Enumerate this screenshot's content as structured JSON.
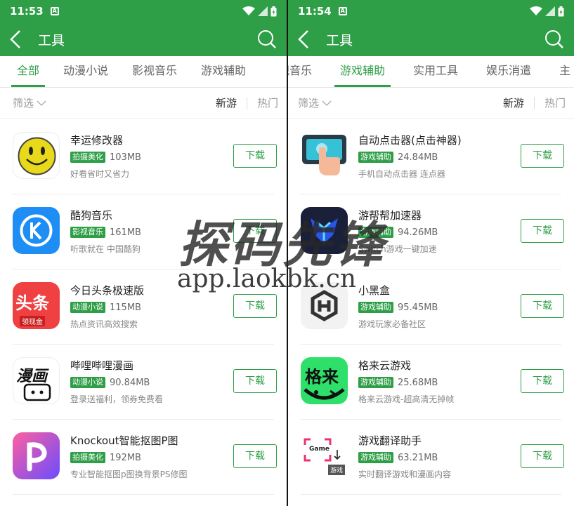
{
  "left": {
    "status": {
      "time": "11:53",
      "notif": "A"
    },
    "header": {
      "title": "工具"
    },
    "tabs": [
      {
        "label": "全部",
        "active": true
      },
      {
        "label": "动漫小说",
        "active": false
      },
      {
        "label": "影视音乐",
        "active": false
      },
      {
        "label": "游戏辅助",
        "active": false
      }
    ],
    "filter": {
      "label": "筛选",
      "sort_new": "新游",
      "sort_hot": "热门"
    },
    "items": [
      {
        "name": "幸运修改器",
        "tag": "拍摄美化",
        "size": "103MB",
        "desc": "好看省时又省力",
        "download": "下载",
        "icon": "smiley-icon"
      },
      {
        "name": "酷狗音乐",
        "tag": "影视音乐",
        "size": "161MB",
        "desc": "听歌就在 中国酷狗",
        "download": "下载",
        "icon": "kugou-icon"
      },
      {
        "name": "今日头条极速版",
        "tag": "动漫小说",
        "size": "115MB",
        "desc": "热点资讯高效搜索",
        "download": "下载",
        "icon": "toutiao-icon",
        "icon_text": "头条",
        "icon_sub": "领现金"
      },
      {
        "name": "哔哩哔哩漫画",
        "tag": "动漫小说",
        "size": "90.84MB",
        "desc": "登录送福利，领券免费看",
        "download": "下载",
        "icon": "bilibili-comic-icon",
        "icon_text": "漫画"
      },
      {
        "name": "Knockout智能抠图P图",
        "tag": "拍摄美化",
        "size": "192MB",
        "desc": "专业智能抠图p图换背景PS修图",
        "download": "下载",
        "icon": "knockout-icon"
      }
    ]
  },
  "right": {
    "status": {
      "time": "11:54",
      "notif": "A"
    },
    "header": {
      "title": "工具"
    },
    "tabs": [
      {
        "label": "视音乐",
        "active": false
      },
      {
        "label": "游戏辅助",
        "active": true
      },
      {
        "label": "实用工具",
        "active": false
      },
      {
        "label": "娱乐消遣",
        "active": false
      },
      {
        "label": "主",
        "active": false
      }
    ],
    "filter": {
      "label": "筛选",
      "sort_new": "新游",
      "sort_hot": "热门"
    },
    "items": [
      {
        "name": "自动点击器(点击神器)",
        "tag": "游戏辅助",
        "size": "24.84MB",
        "desc": "手机自动点击器 连点器",
        "download": "下载",
        "icon": "auto-clicker-icon"
      },
      {
        "name": "游帮帮加速器",
        "tag": "游戏辅助",
        "size": "94.26MB",
        "desc": "Switch游戏一键加速",
        "download": "下载",
        "icon": "accelerator-icon"
      },
      {
        "name": "小黑盒",
        "tag": "游戏辅助",
        "size": "95.45MB",
        "desc": "游戏玩家必备社区",
        "download": "下载",
        "icon": "xiaoheihe-icon"
      },
      {
        "name": "格来云游戏",
        "tag": "游戏辅助",
        "size": "25.68MB",
        "desc": "格来云游戏-超高清无掉帧",
        "download": "下载",
        "icon": "gelai-icon",
        "icon_text": "格来"
      },
      {
        "name": "游戏翻译助手",
        "tag": "游戏辅助",
        "size": "63.21MB",
        "desc": "实时翻译游戏和漫画内容",
        "download": "下载",
        "icon": "game-translate-icon",
        "icon_text": "Game",
        "icon_sub": "游戏"
      }
    ]
  },
  "watermark": {
    "text": "探码先锋",
    "url": "app.laokbk.cn"
  },
  "colors": {
    "brand": "#2e9e47",
    "tag_bg": "#2e9e47"
  }
}
